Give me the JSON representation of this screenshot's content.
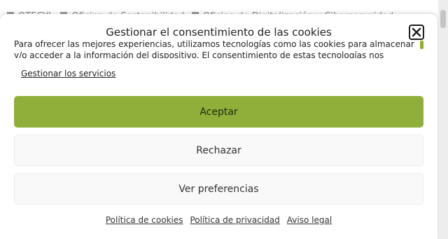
{
  "background_nav": {
    "items": [
      {
        "label": "OTECYL"
      },
      {
        "label": "Oficina de Sostenibilidad"
      },
      {
        "label": "Oficina de Digitalización y Ciberseguridad"
      }
    ]
  },
  "consent": {
    "title": "Gestionar el consentimiento de las cookies",
    "close_icon": "close-icon",
    "message": "Para ofrecer las mejores experiencias, utilizamos tecnologías como las cookies para almacenar y/o acceder a la información del dispositivo. El consentimiento de estas tecnologías nos permitirá procesar",
    "manage_services_label": "Gestionar los servicios",
    "accept_label": "Aceptar",
    "reject_label": "Rechazar",
    "preferences_label": "Ver preferencias",
    "footer_links": {
      "cookie_policy": "Política de cookies",
      "privacy_policy": "Política de privacidad",
      "legal_notice": "Aviso legal"
    },
    "colors": {
      "accent": "#8fae3a"
    }
  }
}
